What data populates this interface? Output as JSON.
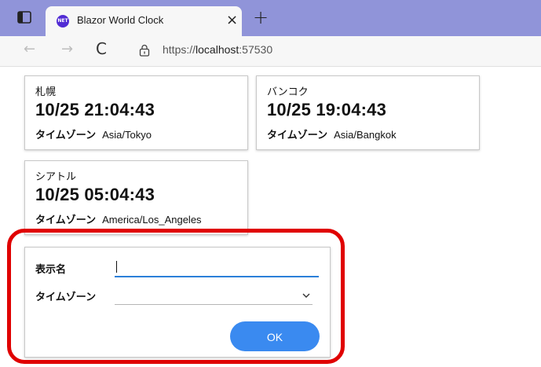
{
  "browser": {
    "tab_title": "Blazor World Clock",
    "favicon_text": "NET",
    "close_glyph": "×",
    "new_tab_glyph": "+",
    "url_scheme": "https://",
    "url_host": "localhost",
    "url_port": ":57530",
    "back_glyph": "←",
    "forward_glyph": "→",
    "reload_glyph": "C"
  },
  "clocks": [
    {
      "name": "札幌",
      "time": "10/25 21:04:43",
      "tz_label": "タイムゾーン",
      "tz": "Asia/Tokyo"
    },
    {
      "name": "バンコク",
      "time": "10/25 19:04:43",
      "tz_label": "タイムゾーン",
      "tz": "Asia/Bangkok"
    },
    {
      "name": "シアトル",
      "time": "10/25 05:04:43",
      "tz_label": "タイムゾーン",
      "tz": "America/Los_Angeles"
    }
  ],
  "form": {
    "display_name_label": "表示名",
    "display_name_value": "",
    "timezone_label": "タイムゾーン",
    "timezone_value": "",
    "ok_label": "OK"
  },
  "colors": {
    "tabbar": "#9094d9",
    "highlight": "#e00000",
    "ok_button": "#3a8af0",
    "input_underline": "#2b7fd9"
  }
}
